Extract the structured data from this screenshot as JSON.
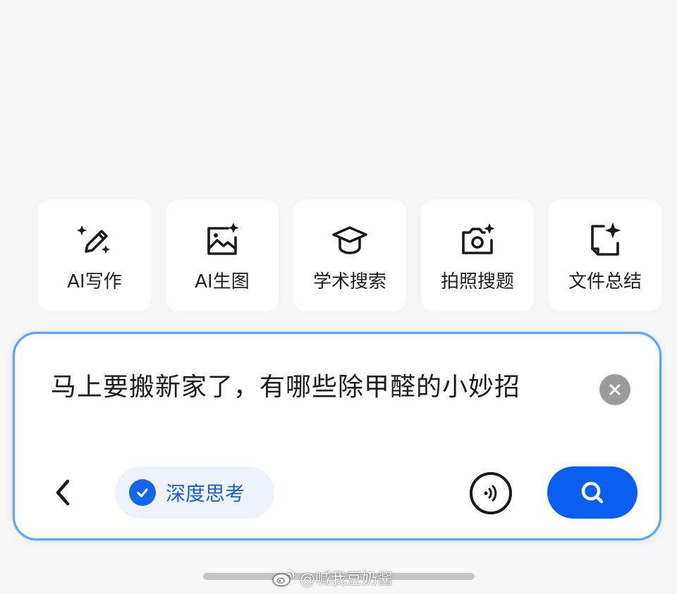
{
  "quick_actions": [
    {
      "label": "AI写作",
      "icon": "pencil-sparkle-icon"
    },
    {
      "label": "AI生图",
      "icon": "image-sparkle-icon"
    },
    {
      "label": "学术搜索",
      "icon": "graduation-cap-icon"
    },
    {
      "label": "拍照搜题",
      "icon": "camera-sparkle-icon"
    },
    {
      "label": "文件总结",
      "icon": "document-sparkle-icon"
    }
  ],
  "input": {
    "query": "马上要搬新家了，有哪些除甲醛的小妙招",
    "clear_icon": "close-circle-icon",
    "back_icon": "chevron-left-icon",
    "deep_think_label": "深度思考",
    "deep_think_checked": true,
    "voice_icon": "voice-wave-icon",
    "search_icon": "search-icon"
  },
  "watermark": {
    "text": "@喊我豆奶酱",
    "icon": "weibo-icon"
  },
  "colors": {
    "background": "#f6f6f7",
    "accent": "#0a5ff0",
    "deep_think_text": "#1a5fd6",
    "deep_think_bg": "#eef2fb",
    "input_border": "#5aa6f2",
    "clear_button": "#9b9b9b"
  }
}
